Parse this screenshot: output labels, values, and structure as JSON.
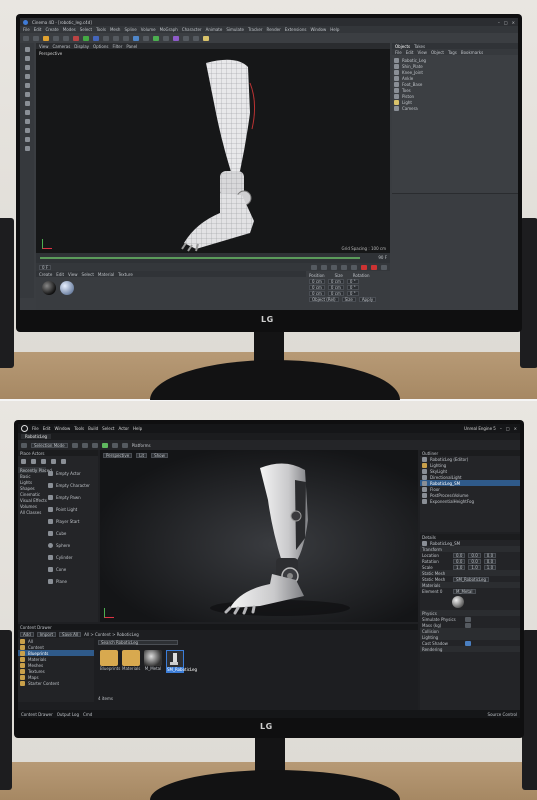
{
  "top": {
    "app_title": "Cinema 4D - [robotic_leg.c4d]",
    "menus": [
      "File",
      "Edit",
      "Create",
      "Modes",
      "Select",
      "Tools",
      "Mesh",
      "Spline",
      "Volume",
      "MoGraph",
      "Character",
      "Animate",
      "Simulate",
      "Tracker",
      "Render",
      "Extensions",
      "Window",
      "Help"
    ],
    "viewport_label": "Perspective",
    "viewport_menus": [
      "View",
      "Cameras",
      "Display",
      "Options",
      "Filter",
      "Panel"
    ],
    "viewport_footer": "Grid Spacing : 100 cm",
    "object_tabs": [
      "Objects",
      "Takes"
    ],
    "object_menus": [
      "File",
      "Edit",
      "View",
      "Object",
      "Tags",
      "Bookmarks"
    ],
    "objects": [
      "Robotic_Leg",
      "Shin_Plate",
      "Knee_Joint",
      "Ankle",
      "Foot_Base",
      "Toes",
      "Piston",
      "Light",
      "Camera"
    ],
    "frame_readout": "0 F",
    "frame_end": "90 F",
    "material_tabs": [
      "Create",
      "Edit",
      "View",
      "Select",
      "Material",
      "Texture"
    ],
    "coord_headers": [
      "Position",
      "Size",
      "Rotation"
    ],
    "coord_values": [
      "0 cm",
      "0 cm",
      "0 °",
      "0 cm",
      "0 cm",
      "0 °",
      "0 cm",
      "0 cm",
      "0 °"
    ],
    "coord_mode": "Object (Rel)",
    "coord_size_mode": "Size",
    "apply_label": "Apply",
    "brand": "LG"
  },
  "bottom": {
    "app_title": "Unreal Engine 5",
    "project_tab": "RoboticLeg",
    "menus": [
      "File",
      "Edit",
      "Window",
      "Tools",
      "Build",
      "Select",
      "Actor",
      "Help"
    ],
    "mode_label": "Selection Mode",
    "platforms": "Platforms",
    "viewport_buttons": [
      "Perspective",
      "Lit",
      "Show"
    ],
    "place_actors_title": "Place Actors",
    "place_categories": [
      "Recently Placed",
      "Basic",
      "Lights",
      "Shapes",
      "Cinematic",
      "Visual Effects",
      "Volumes",
      "All Classes"
    ],
    "place_items": [
      "Empty Actor",
      "Empty Character",
      "Empty Pawn",
      "Point Light",
      "Player Start",
      "Cube",
      "Sphere",
      "Cylinder",
      "Cone",
      "Plane"
    ],
    "outliner_title": "Outliner",
    "outliner_items": [
      "RoboticLeg (Editor)",
      "Lighting",
      "SkyLight",
      "DirectionalLight",
      "RoboticLeg_SM",
      "Floor",
      "PostProcessVolume",
      "ExponentialHeightFog"
    ],
    "details_title": "Details",
    "details_selected": "RoboticLeg_SM",
    "details_sections": [
      "Transform",
      "Static Mesh",
      "Materials",
      "Physics",
      "Collision",
      "Lighting",
      "Rendering"
    ],
    "details_labels": [
      "Location",
      "Rotation",
      "Scale",
      "Static Mesh",
      "Element 0",
      "Simulate Physics",
      "Mass (kg)",
      "Cast Shadow"
    ],
    "details_values": [
      "0.0",
      "0.0",
      "0.0",
      "0.0",
      "0.0",
      "0.0",
      "1.0",
      "1.0",
      "1.0"
    ],
    "mesh_value": "SM_RoboticLeg",
    "material_value": "M_Metal",
    "content_title": "Content Drawer",
    "content_tabs": [
      "Add",
      "Import",
      "Save All"
    ],
    "content_path": "All > Content > RoboticLeg",
    "content_search": "Search RoboticLeg",
    "content_folders": [
      "All",
      "Content",
      "Blueprints",
      "Materials",
      "Meshes",
      "Textures",
      "Maps",
      "Starter Content"
    ],
    "content_assets": [
      "Blueprints",
      "Materials",
      "M_Metal",
      "SM_RoboticLeg"
    ],
    "status_items": [
      "Content Drawer",
      "Output Log",
      "Cmd"
    ],
    "status_right": "Source Control",
    "item_count": "4 items",
    "brand": "LG"
  }
}
